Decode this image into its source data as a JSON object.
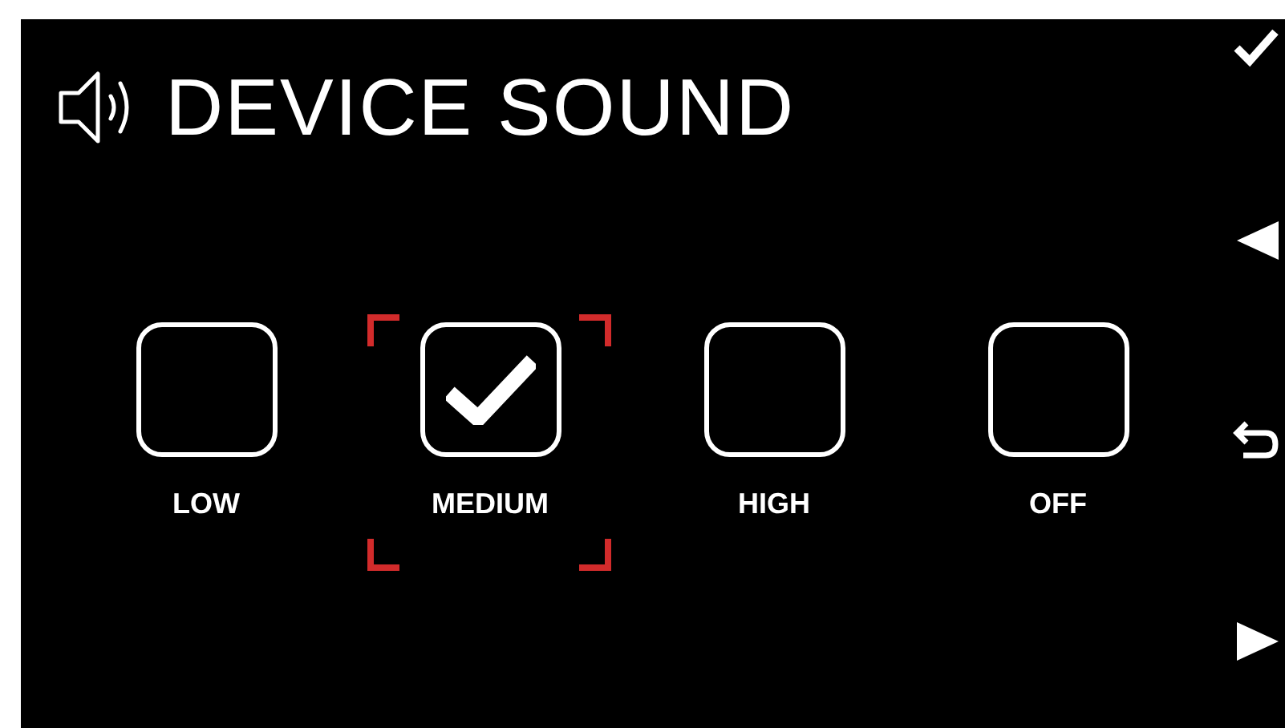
{
  "screen": {
    "title": "DEVICE SOUND"
  },
  "options": [
    {
      "label": "LOW",
      "checked": false,
      "focused": false
    },
    {
      "label": "MEDIUM",
      "checked": true,
      "focused": true
    },
    {
      "label": "HIGH",
      "checked": false,
      "focused": false
    },
    {
      "label": "OFF",
      "checked": false,
      "focused": false
    }
  ],
  "softkeys": [
    {
      "kind": "confirm"
    },
    {
      "kind": "left"
    },
    {
      "kind": "back"
    },
    {
      "kind": "right"
    }
  ]
}
